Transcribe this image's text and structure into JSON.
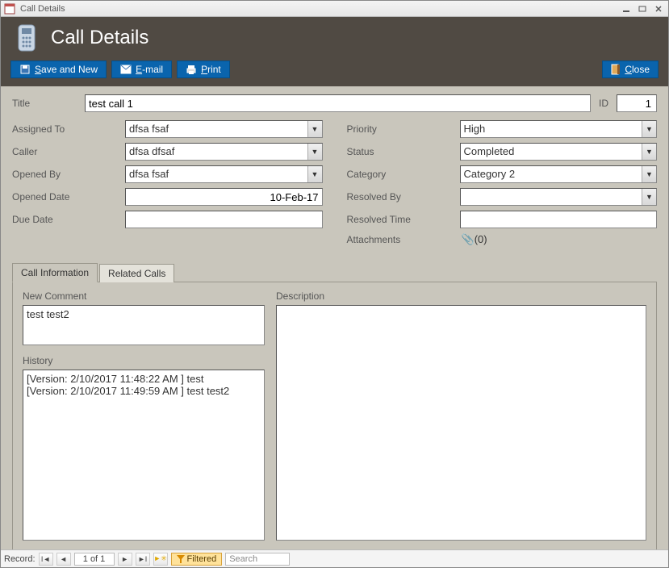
{
  "window": {
    "title": "Call Details"
  },
  "header": {
    "title": "Call Details"
  },
  "toolbar": {
    "save_new": "Save and New",
    "email": "E-mail",
    "print": "Print",
    "close": "Close"
  },
  "fields": {
    "title_label": "Title",
    "title_value": "test call 1",
    "id_label": "ID",
    "id_value": "1",
    "assigned_to_label": "Assigned To",
    "assigned_to_value": "dfsa fsaf",
    "caller_label": "Caller",
    "caller_value": "dfsa dfsaf",
    "opened_by_label": "Opened By",
    "opened_by_value": "dfsa fsaf",
    "opened_date_label": "Opened Date",
    "opened_date_value": "10-Feb-17",
    "due_date_label": "Due Date",
    "due_date_value": "",
    "priority_label": "Priority",
    "priority_value": "High",
    "status_label": "Status",
    "status_value": "Completed",
    "category_label": "Category",
    "category_value": "Category 2",
    "resolved_by_label": "Resolved By",
    "resolved_by_value": "",
    "resolved_time_label": "Resolved Time",
    "resolved_time_value": "",
    "attachments_label": "Attachments",
    "attachments_value": "(0)"
  },
  "tabs": {
    "call_info": "Call Information",
    "related": "Related Calls"
  },
  "panel": {
    "new_comment_label": "New Comment",
    "new_comment_value": "test test2",
    "history_label": "History",
    "history_value": "[Version: 2/10/2017 11:48:22 AM ] test\n[Version: 2/10/2017 11:49:59 AM ] test test2",
    "description_label": "Description",
    "description_value": ""
  },
  "recnav": {
    "label": "Record:",
    "position": "1 of 1",
    "filtered": "Filtered",
    "search_placeholder": "Search"
  }
}
